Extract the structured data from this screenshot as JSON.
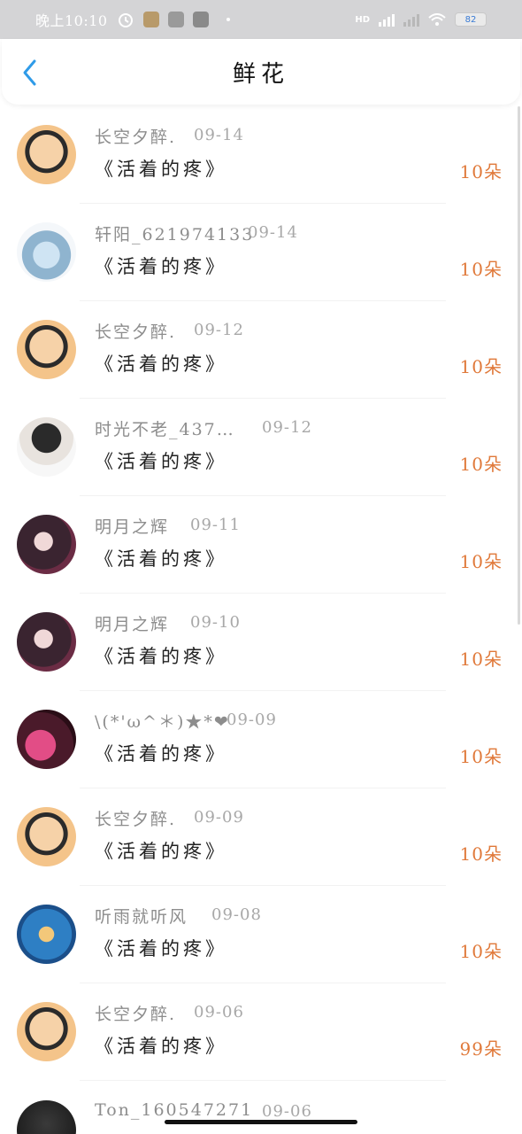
{
  "status_bar": {
    "time": "晚上10:10",
    "network_label": "HD",
    "battery": "82"
  },
  "nav": {
    "title": "鲜花"
  },
  "colors": {
    "accent": "#2f9be8",
    "count": "#e0793a",
    "muted": "#a8a8a8"
  },
  "icons": {
    "back": "chevron-left-icon",
    "alarm": "alarm-icon",
    "wifi": "wifi-icon",
    "battery": "battery-icon"
  },
  "records": [
    {
      "username": "长空夕醉.",
      "date": "09-14",
      "book": "《活着的疼》",
      "count": "10朵",
      "avatar": "crayon-shin"
    },
    {
      "username": "轩阳_621974133",
      "date": "09-14",
      "book": "《活着的疼》",
      "count": "10朵",
      "avatar": "glass-harp"
    },
    {
      "username": "长空夕醉.",
      "date": "09-12",
      "book": "《活着的疼》",
      "count": "10朵",
      "avatar": "crayon-shin"
    },
    {
      "username": "时光不老_437…",
      "date": "09-12",
      "book": "《活着的疼》",
      "count": "10朵",
      "avatar": "boy-portrait"
    },
    {
      "username": "明月之辉",
      "date": "09-11",
      "book": "《活着的疼》",
      "count": "10朵",
      "avatar": "anime-girl"
    },
    {
      "username": "明月之辉",
      "date": "09-10",
      "book": "《活着的疼》",
      "count": "10朵",
      "avatar": "anime-girl"
    },
    {
      "username": "\\(*'ω^＊)★*❤",
      "date": "09-09",
      "book": "《活着的疼》",
      "count": "10朵",
      "avatar": "pink-photo"
    },
    {
      "username": "长空夕醉.",
      "date": "09-09",
      "book": "《活着的疼》",
      "count": "10朵",
      "avatar": "crayon-shin"
    },
    {
      "username": "听雨就听风",
      "date": "09-08",
      "book": "《活着的疼》",
      "count": "10朵",
      "avatar": "blue-art"
    },
    {
      "username": "长空夕醉.",
      "date": "09-06",
      "book": "《活着的疼》",
      "count": "99朵",
      "avatar": "crayon-shin"
    }
  ],
  "partial_row": {
    "username": "Ton_160547271",
    "date": "09-06"
  }
}
